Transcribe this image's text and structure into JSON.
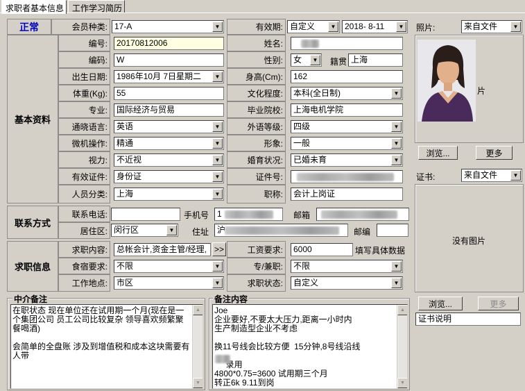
{
  "tabs": [
    "求职者基本信息",
    "工作学习简历"
  ],
  "status": "正常",
  "sections": {
    "basic": "基本资料",
    "contact": "联系方式",
    "job": "求职信息"
  },
  "labels": {
    "member_type": "会员种类:",
    "validity": "有效期:",
    "number": "编号:",
    "name": "姓名:",
    "code": "编码:",
    "gender": "性别:",
    "native": "籍贯",
    "birth": "出生日期:",
    "height": "身高(Cm):",
    "weight": "体重(Kg):",
    "education": "文化程度:",
    "major": "专业:",
    "school": "毕业院校:",
    "language": "通晓语言:",
    "foreign_level": "外语等级:",
    "computer": "微机操作:",
    "appearance": "形象:",
    "vision": "视力:",
    "marital": "婚育状况:",
    "id_type": "有效证件:",
    "id_number": "证件号:",
    "person_class": "人员分类:",
    "title": "职称:",
    "phone": "联系电话:",
    "mobile": "手机号",
    "email": "邮箱",
    "residence": "居住区:",
    "address": "住址",
    "postcode": "邮编",
    "job_content": "求职内容:",
    "salary": "工资要求:",
    "salary_note": "填写具体数据",
    "lodging": "食宿要求:",
    "fulltime": "专/兼职:",
    "location": "工作地点:",
    "job_status": "求职状态:",
    "photo": "照片:",
    "certificate": "证书:"
  },
  "values": {
    "member_type": "17-A",
    "validity_type": "自定义",
    "validity_date": "2018- 8-11",
    "number": "20170812006",
    "code": "W",
    "gender": "女",
    "native": "上海",
    "birth": "1986年10月 7日星期二",
    "height": "162",
    "weight": "55",
    "education": "本科(全日制)",
    "major": "国际经济与贸易",
    "school": "上海电机学院",
    "language": "英语",
    "foreign_level": "四级",
    "computer": "精通",
    "appearance": "一般",
    "vision": "不近视",
    "marital": "已婚未育",
    "id_type": "身份证",
    "person_class": "上海",
    "title": "会计上岗证",
    "residence": "闵行区",
    "job_content": "总帐会计,资金主管/经理,",
    "salary": "6000",
    "lodging": "不限",
    "fulltime": "不限",
    "location": "市区",
    "job_status": "自定义",
    "photo_source": "来自文件",
    "cert_source": "来自文件",
    "mobile_prefix": "1",
    "address_prefix": "沪"
  },
  "photo_caption": "片",
  "no_image": "没有图片",
  "buttons": {
    "browse": "浏览...",
    "more": "更多",
    "more_jobs": ">>"
  },
  "cert_desc": "证书说明",
  "agent_note_title": "中介备注",
  "agent_note": "在职状态 现在单位还在试用期一个月(现在是一个集团公司 员工公司比较复杂 领导喜欢频繁聚餐喝酒)\n\n会简单的全盘账 涉及到增值税和成本这块需要有人带",
  "remark_title": "备注内容",
  "remark": "Joe\n企业要好,不要太大压力,距离一小时内\n生产制造型企业不考虑\n\n换11号线会比较方便  15分钟,8号线沿线\n\n     录用\n4800*0.75=3600 试用期三个月\n转正6k 9.11到岗"
}
